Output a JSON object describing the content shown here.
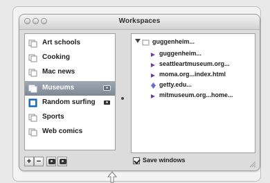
{
  "window": {
    "title": "Workspaces"
  },
  "left_panel": {
    "items": [
      {
        "label": "Art schools"
      },
      {
        "label": "Cooking"
      },
      {
        "label": "Mac news"
      },
      {
        "label": "Museums"
      },
      {
        "label": "Random surfing"
      },
      {
        "label": "Sports"
      },
      {
        "label": "Web comics"
      }
    ],
    "selected_index": 3
  },
  "right_panel": {
    "group": {
      "label": "guggenheim..."
    },
    "children": [
      {
        "label": "guggenheim...",
        "icon": "link-icon"
      },
      {
        "label": "seattleartmuseum.org...",
        "icon": "link-icon"
      },
      {
        "label": "moma.org...index.html",
        "icon": "link-icon"
      },
      {
        "label": "getty.edu...",
        "icon": "document-icon"
      },
      {
        "label": "mitmuseum.org...home...",
        "icon": "link-icon"
      }
    ]
  },
  "bottom": {
    "add_label": "+",
    "remove_label": "−",
    "save_windows_label": "Save windows",
    "save_windows_checked": true
  },
  "colors": {
    "selection_start": "#9fa8b3",
    "selection_end": "#7f8996",
    "accent_purple": "#6b3fa0",
    "folder_blue": "#1f7bd8"
  }
}
